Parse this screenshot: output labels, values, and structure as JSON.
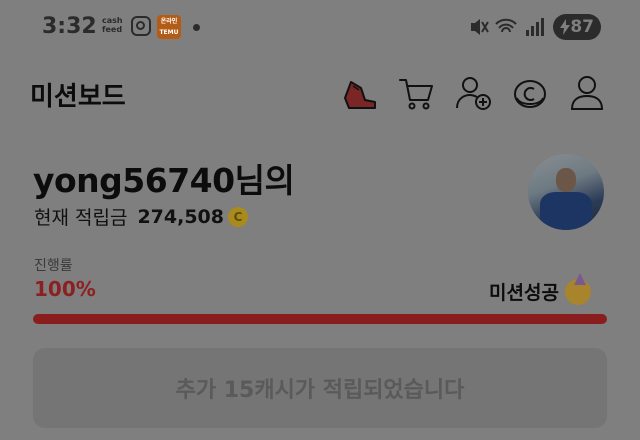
{
  "status_bar": {
    "time": "3:32",
    "cashfeed_line1": "cash",
    "cashfeed_line2": "feed",
    "temu_line1": "온라인",
    "temu_line2": "TEMU",
    "battery": "87",
    "icons": [
      "instagram-icon",
      "temu-icon",
      "notification-dot-icon",
      "mute-icon",
      "wifi-icon",
      "signal-icon",
      "battery-icon"
    ]
  },
  "header": {
    "title": "미션보드",
    "icons": [
      "sneaker-icon",
      "cart-icon",
      "add-friend-icon",
      "coin-icon",
      "profile-icon"
    ]
  },
  "user": {
    "name": "yong56740님의",
    "balance_label": "현재 적립금",
    "balance_value": "274,508",
    "coin_symbol": "C"
  },
  "progress": {
    "label": "진행률",
    "value_text": "100%",
    "percent": 100,
    "status_text": "미션성공"
  },
  "banner": {
    "message": "추가 15캐시가 적립되었습니다"
  },
  "colors": {
    "overlay": "#7f7f7f",
    "accent_red": "#8a1e1e",
    "coin_gold": "#a98a1c"
  }
}
